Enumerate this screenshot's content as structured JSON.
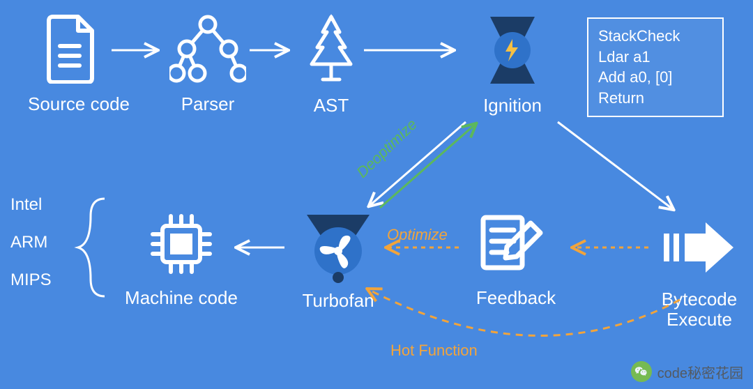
{
  "nodes": {
    "source": {
      "label": "Source code"
    },
    "parser": {
      "label": "Parser"
    },
    "ast": {
      "label": "AST"
    },
    "ignition": {
      "label": "Ignition"
    },
    "bytecode": {
      "label": "Bytecode\nExecute"
    },
    "feedback": {
      "label": "Feedback"
    },
    "turbofan": {
      "label": "Turbofan"
    },
    "machine": {
      "label": "Machine code"
    },
    "archs": [
      "Intel",
      "ARM",
      "MIPS"
    ]
  },
  "codebox": "StackCheck\nLdar a1\nAdd a0, [0]\nReturn",
  "edge_labels": {
    "deoptimize": "Deoptimize",
    "optimize": "Optimize",
    "hotfunction": "Hot Function"
  },
  "watermark": "code秘密花园",
  "colors": {
    "bg": "#4889E0",
    "white": "#FFFFFF",
    "green": "#5CB85C",
    "orange": "#F2A43B",
    "darkblue": "#1B3C66"
  }
}
